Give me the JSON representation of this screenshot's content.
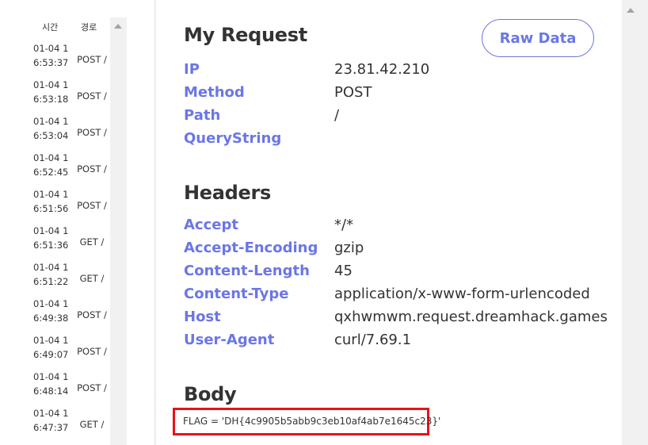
{
  "request_list": {
    "headers": {
      "time": "시간",
      "path": "경로"
    },
    "rows": [
      {
        "time": "01-04 1 6:53:37",
        "path": "POST /"
      },
      {
        "time": "01-04 1 6:53:18",
        "path": "POST /"
      },
      {
        "time": "01-04 1 6:53:04",
        "path": "POST /"
      },
      {
        "time": "01-04 1 6:52:45",
        "path": "POST /"
      },
      {
        "time": "01-04 1 6:51:56",
        "path": "POST /"
      },
      {
        "time": "01-04 1 6:51:36",
        "path": "GET /"
      },
      {
        "time": "01-04 1 6:51:22",
        "path": "GET /"
      },
      {
        "time": "01-04 1 6:49:38",
        "path": "POST /"
      },
      {
        "time": "01-04 1 6:49:07",
        "path": "POST /"
      },
      {
        "time": "01-04 1 6:48:14",
        "path": "POST /"
      },
      {
        "time": "01-04 1 6:47:37",
        "path": "GET /"
      }
    ]
  },
  "my_request": {
    "title": "My Request",
    "raw_button": "Raw Data",
    "fields": [
      {
        "key": "IP",
        "value": "23.81.42.210"
      },
      {
        "key": "Method",
        "value": "POST"
      },
      {
        "key": "Path",
        "value": "/"
      },
      {
        "key": "QueryString",
        "value": ""
      }
    ]
  },
  "headers": {
    "title": "Headers",
    "fields": [
      {
        "key": "Accept",
        "value": "*/*"
      },
      {
        "key": "Accept-Encoding",
        "value": "gzip"
      },
      {
        "key": "Content-Length",
        "value": "45"
      },
      {
        "key": "Content-Type",
        "value": "application/x-www-form-urlencoded"
      },
      {
        "key": "Host",
        "value": "qxhwmwm.request.dreamhack.games"
      },
      {
        "key": "User-Agent",
        "value": "curl/7.69.1"
      }
    ]
  },
  "body": {
    "title": "Body",
    "content": "FLAG = 'DH{4c9905b5abb9c3eb10af4ab7e1645c23}'"
  },
  "colors": {
    "accent": "#6b76e6",
    "highlight_border": "#e8121b"
  },
  "icons": {
    "scroll_up": "scroll-up-arrow-icon"
  }
}
